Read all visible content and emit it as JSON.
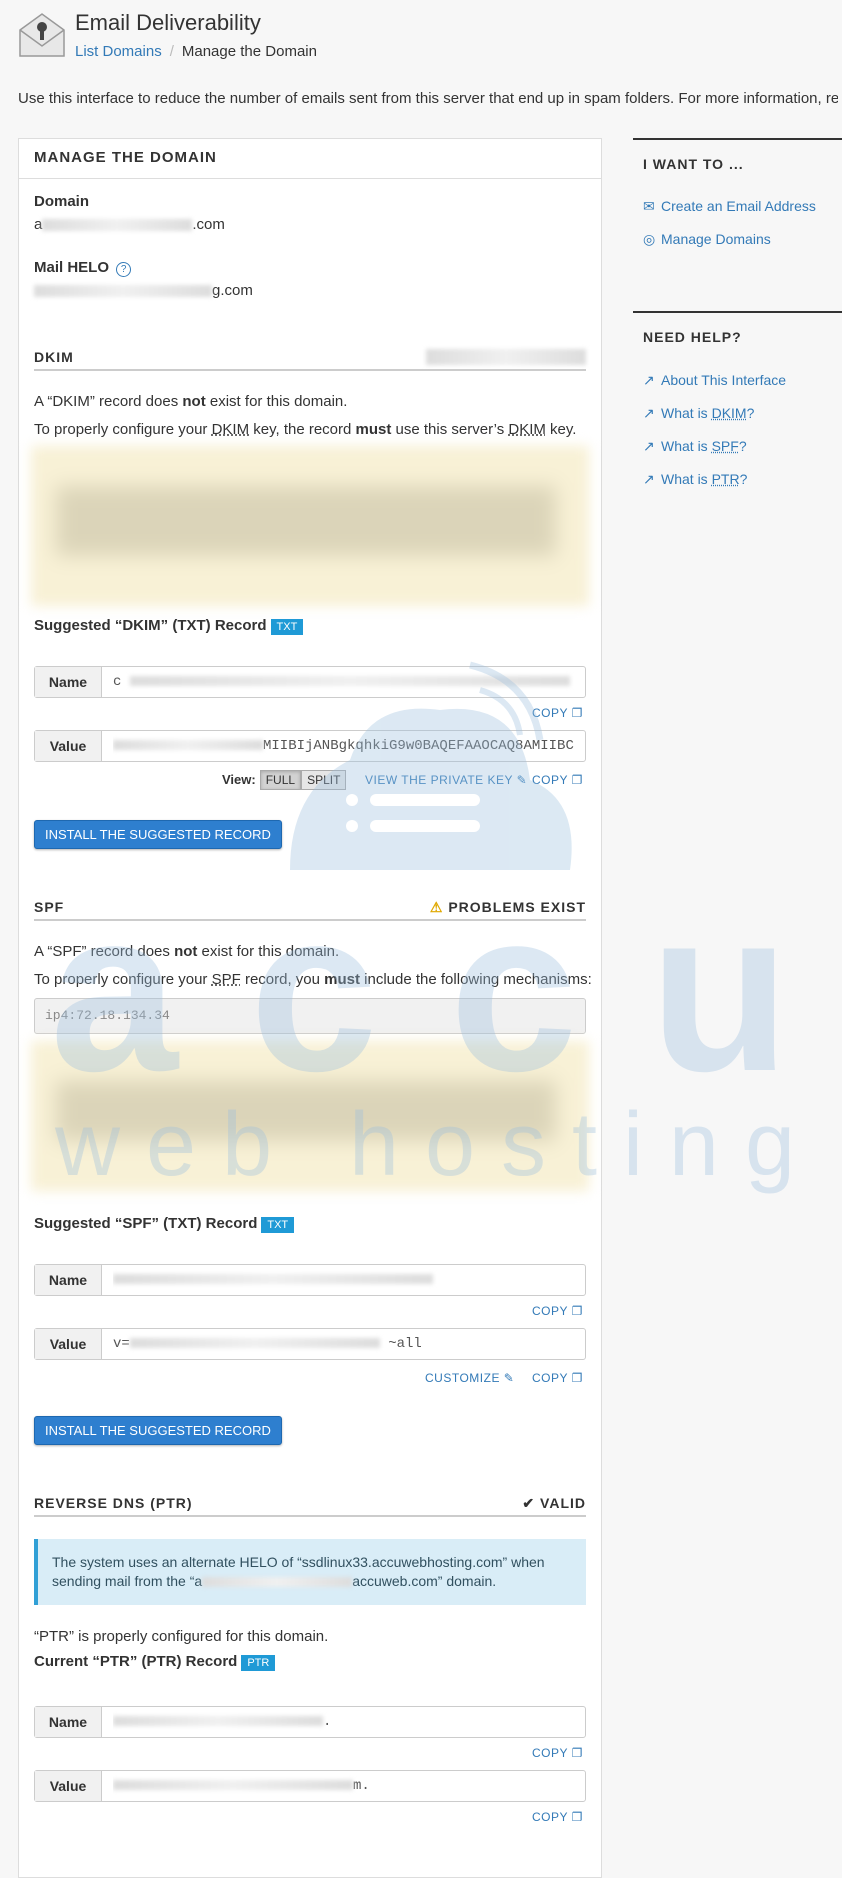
{
  "header": {
    "title": "Email Deliverability",
    "breadcrumb": {
      "link": "List Domains",
      "current": "Manage the Domain"
    }
  },
  "intro": "Use this interface to reduce the number of emails sent from this server that end up in spam folders. For more information, rea",
  "panel": {
    "title": "MANAGE THE DOMAIN",
    "domain_label": "Domain",
    "domain_value_suffix": ".com",
    "helo_label": "Mail HELO",
    "helo_value_suffix": "g.com",
    "dkim": {
      "title": "DKIM",
      "line1_pre": "A “DKIM” record does ",
      "line1_bold": "not",
      "line1_post": " exist for this domain.",
      "line2_pre": "To properly configure your ",
      "line2_abbr": "DKIM",
      "line2_mid": " key, the record ",
      "line2_bold": "must",
      "line2_mid2": " use this server’s ",
      "line2_abbr2": "DKIM",
      "line2_post": " key.",
      "suggested_label": "Suggested “DKIM” (TXT) Record",
      "badge": "TXT",
      "name_label": "Name",
      "name_value": "c",
      "value_label": "Value",
      "value_value": "MIIBIjANBgkqhkiG9w0BAQEFAAOCAQ8AMIIBC",
      "view_label": "View:",
      "view_full": "FULL",
      "view_split": "SPLIT",
      "view_private": "VIEW THE PRIVATE KEY",
      "copy": "COPY",
      "install": "INSTALL THE SUGGESTED RECORD"
    },
    "spf": {
      "title": "SPF",
      "status": "PROBLEMS EXIST",
      "line1_pre": "A “SPF” record does ",
      "line1_bold": "not",
      "line1_post": " exist for this domain.",
      "line2_pre": "To properly configure your ",
      "line2_abbr": "SPF",
      "line2_mid": " record, you ",
      "line2_bold": "must",
      "line2_post": " include the following mechanisms:",
      "mechanism": "ip4:72.18.134.34",
      "suggested_label": "Suggested “SPF” (TXT) Record",
      "badge": "TXT",
      "name_label": "Name",
      "value_label": "Value",
      "value_prefix": "v=",
      "value_suffix": "~all",
      "customize": "CUSTOMIZE",
      "copy": "COPY",
      "install": "INSTALL THE SUGGESTED RECORD"
    },
    "ptr": {
      "title": "REVERSE DNS (PTR)",
      "status": "VALID",
      "alert_line1": "The system uses an alternate HELO of “ssdlinux33.accuwebhosting.com” when",
      "alert_line2_pre": "sending mail from the “a",
      "alert_line2_post": "accuweb.com” domain.",
      "configured": "“PTR” is properly configured for this domain.",
      "current_label": "Current “PTR” (PTR) Record",
      "badge": "PTR",
      "name_label": "Name",
      "name_value": ".",
      "value_label": "Value",
      "value_value": "m.",
      "copy": "COPY"
    }
  },
  "sidebar": {
    "want_title": "I WANT TO ...",
    "want_links": [
      "Create an Email Address",
      "Manage Domains"
    ],
    "help_title": "NEED HELP?",
    "help_links": [
      {
        "pre": "About This Interface",
        "abbr": "",
        "post": ""
      },
      {
        "pre": "What is ",
        "abbr": "DKIM",
        "post": "?"
      },
      {
        "pre": "What is ",
        "abbr": "SPF",
        "post": "?"
      },
      {
        "pre": "What is ",
        "abbr": "PTR",
        "post": "?"
      }
    ]
  },
  "watermark": {
    "brand": "accu",
    "tagline": "web hosting",
    "color": "#9cbfde"
  },
  "colors": {
    "link": "#337ab7",
    "primary_button": "#2e7fcf",
    "badge": "#1f9ad6",
    "warning": "#e0a800",
    "alert_bg": "#d9edf7"
  }
}
